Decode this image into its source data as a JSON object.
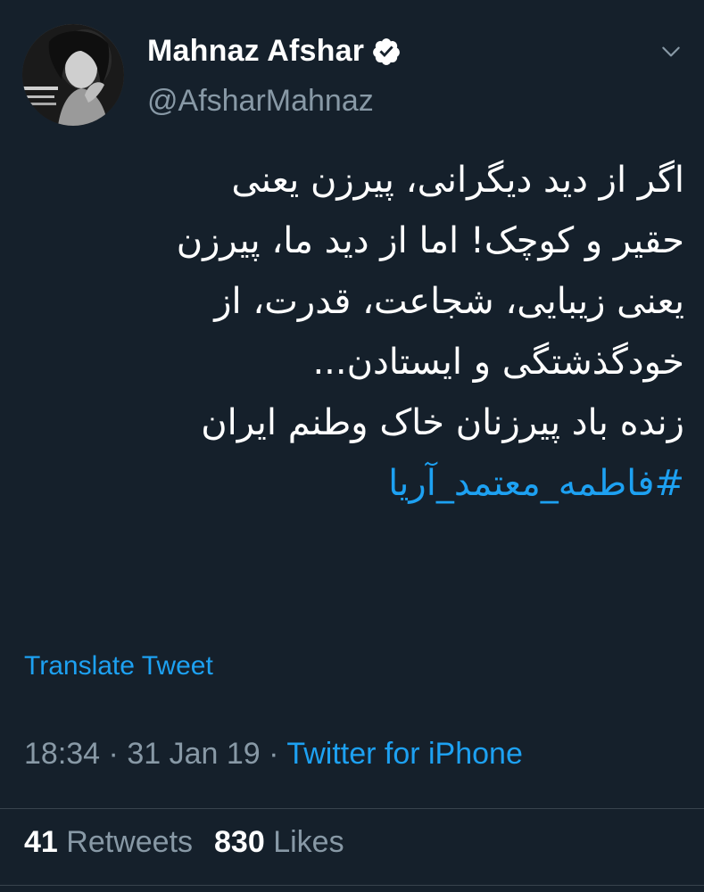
{
  "author": {
    "display_name": "Mahnaz Afshar",
    "handle": "@AfsharMahnaz",
    "verified": true,
    "avatar_icon": "profile-photo"
  },
  "tweet": {
    "lines": [
      "اگر از دید دیگرانی، پیرزن یعنی",
      "حقیر و کوچک! اما از دید ما، پیرزن",
      "یعنی زیبایی، شجاعت، قدرت، از",
      "خودگذشتگی و ایستادن...",
      "زنده باد پیرزنان خاک وطنم ایران"
    ],
    "hashtag": "#فاطمه_معتمد_آریا"
  },
  "translate_label": "Translate Tweet",
  "meta": {
    "time": "18:34",
    "date": "31 Jan 19",
    "separator": "·",
    "source": "Twitter for iPhone"
  },
  "stats": {
    "retweets_count": "41",
    "retweets_label": "Retweets",
    "likes_count": "830",
    "likes_label": "Likes"
  },
  "colors": {
    "background": "#15202b",
    "link": "#1da1f2",
    "secondary_text": "#8899a6",
    "primary_text": "#ffffff"
  }
}
